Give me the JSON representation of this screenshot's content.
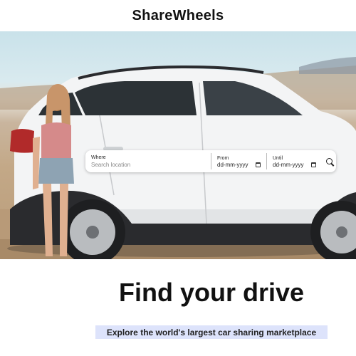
{
  "header": {
    "brand": "ShareWheels"
  },
  "search": {
    "where_label": "Where",
    "where_placeholder": "Search location",
    "from_label": "From",
    "from_value": "dd-mm-yyyy",
    "until_label": "Until",
    "until_value": "dd-mm-yyyy"
  },
  "icons": {
    "calendar": "calendar-icon",
    "search": "search-icon"
  },
  "hero": {
    "headline": "Find your drive",
    "tagline": "Explore the world's largest car sharing marketplace"
  }
}
